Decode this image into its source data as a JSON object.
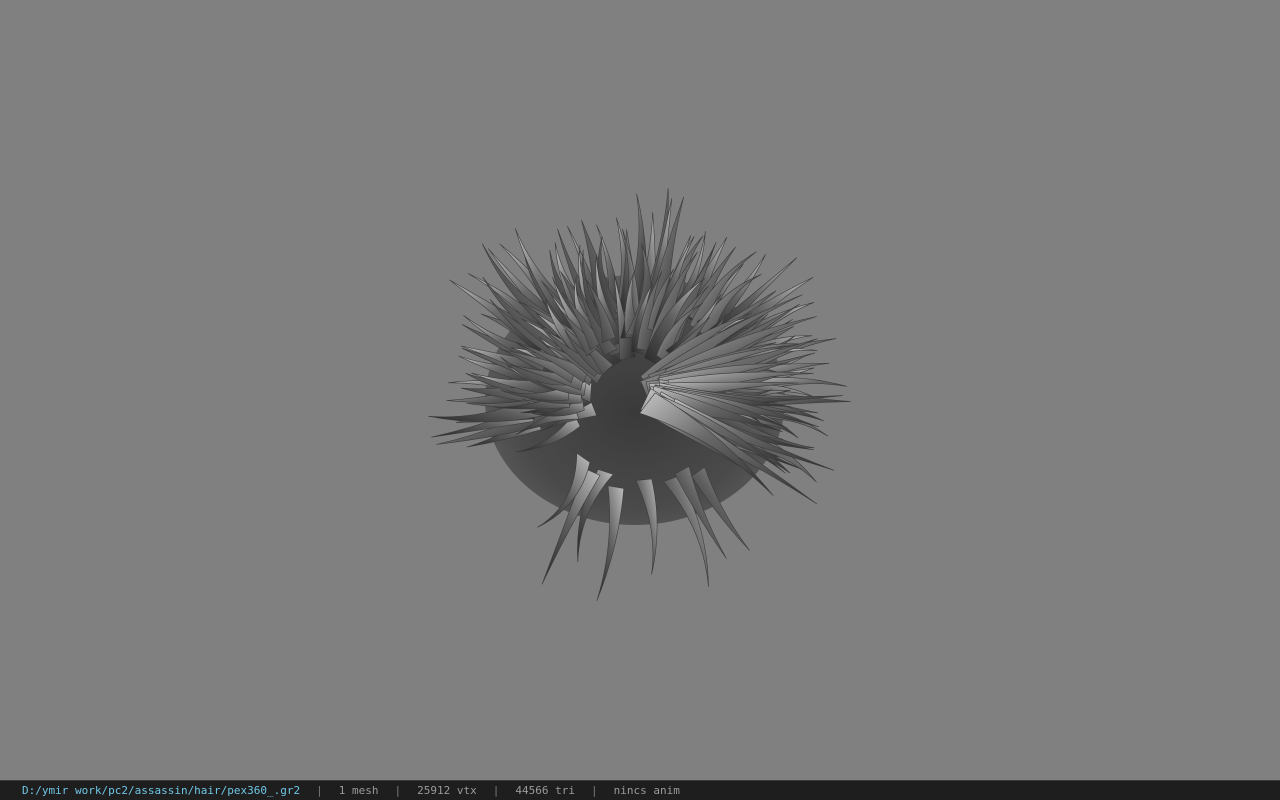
{
  "viewer": {
    "background_color": "#808080",
    "model": {
      "icon": "hair-mesh-icon",
      "shade_dark": "#2a2a2a",
      "shade_mid": "#5a5a5a",
      "shade_light": "#b8b8b8"
    }
  },
  "status_bar": {
    "file_path": "D:/ymir work/pc2/assassin/hair/pex360_.gr2",
    "mesh_count": "1 mesh",
    "vertex_count": "25912 vtx",
    "triangle_count": "44566 tri",
    "animation": "nincs anim",
    "separator": "|",
    "path_color": "#6ec6e6"
  }
}
